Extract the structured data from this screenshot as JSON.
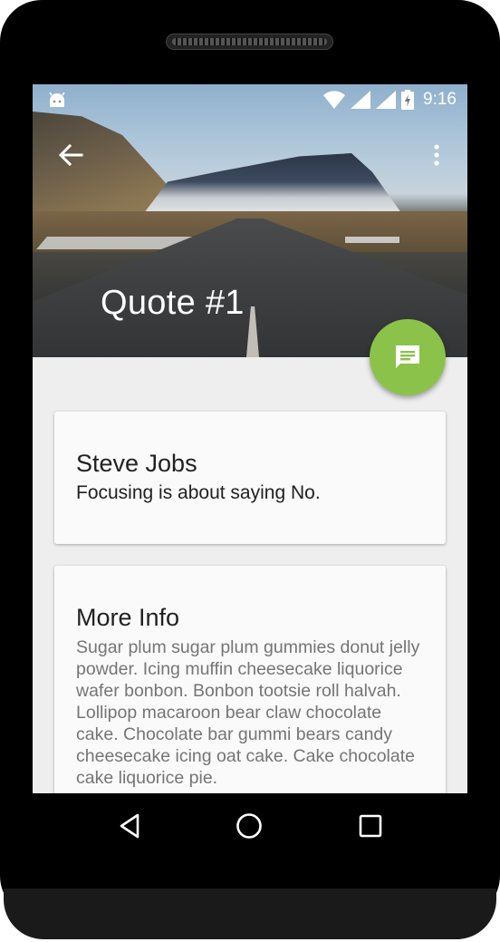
{
  "statusbar": {
    "time": "9:16"
  },
  "toolbar": {
    "title": "Quote #1"
  },
  "quote_card": {
    "author": "Steve Jobs",
    "quote": "Focusing is about saying No."
  },
  "info_card": {
    "title": "More Info",
    "body": "Sugar plum sugar plum gummies donut jelly powder. Icing muffin cheesecake liquorice wafer bonbon. Bonbon tootsie roll halvah. Lollipop macaroon bear claw chocolate cake. Chocolate bar gummi bears candy cheesecake icing oat cake. Cake chocolate cake liquorice pie."
  },
  "colors": {
    "fab": "#8bc34a",
    "card": "#fafafa",
    "background": "#eeeeee"
  },
  "icons": [
    "android-icon",
    "wifi-icon",
    "cell-signal-icon",
    "battery-icon",
    "back-arrow-icon",
    "more-vert-icon",
    "message-icon",
    "nav-back-icon",
    "nav-home-icon",
    "nav-recents-icon"
  ]
}
